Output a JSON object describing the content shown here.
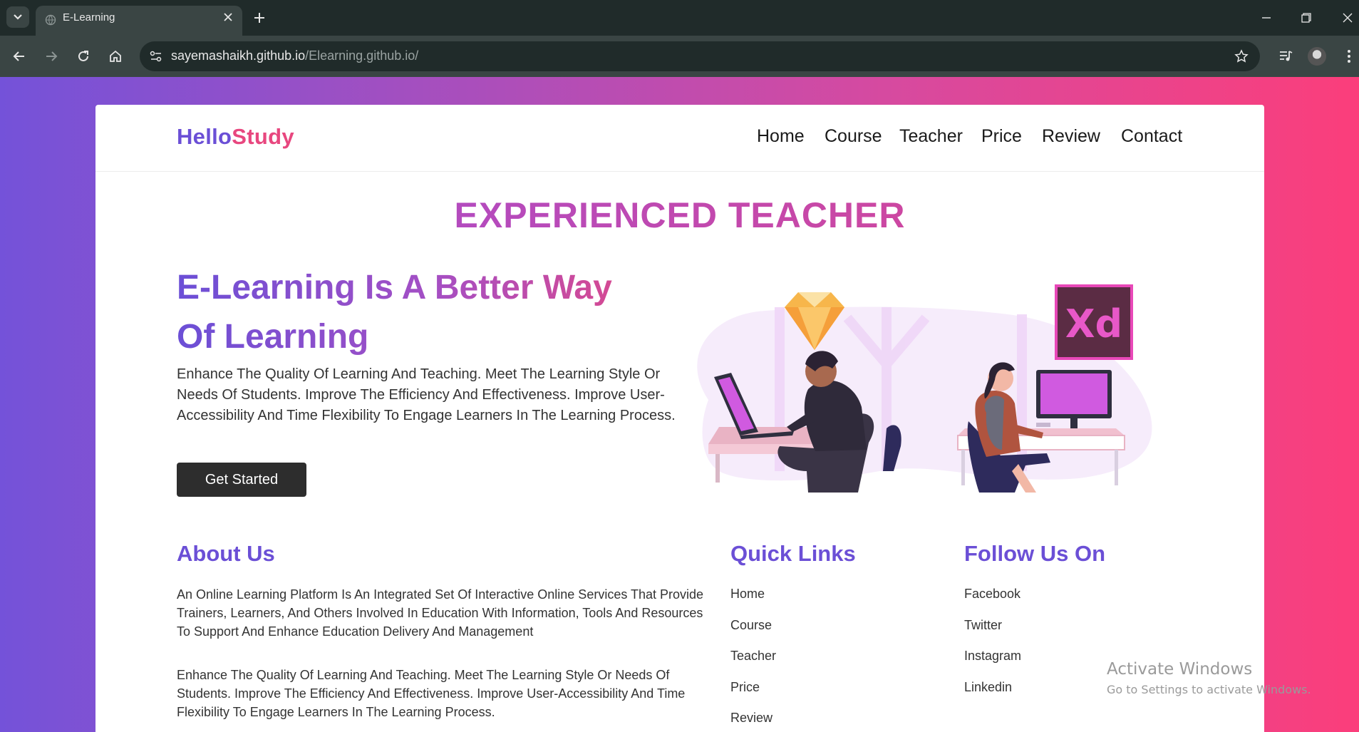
{
  "browser": {
    "tab_title": "E-Learning",
    "url_host": "sayemashaikh.github.io",
    "url_path": "/Elearning.github.io/"
  },
  "site": {
    "logo_part1": "Hello",
    "logo_part2": "Study",
    "nav": [
      "Home",
      "Course",
      "Teacher",
      "Price",
      "Review",
      "Contact"
    ]
  },
  "hero": {
    "section_title": "EXPERIENCED TEACHER",
    "heading_line1": "E-Learning Is A Better Way",
    "heading_line2": "Of Learning",
    "text": "Enhance The Quality Of Learning And Teaching. Meet The Learning Style Or Needs Of Students. Improve The Efficiency And Effectiveness. Improve User-Accessibility And Time Flexibility To Engage Learners In The Learning Process.",
    "cta": "Get Started",
    "badge_label": "Xd"
  },
  "footer": {
    "about_title": "About Us",
    "about_p1": "An Online Learning Platform Is An Integrated Set Of Interactive Online Services That Provide Trainers, Learners, And Others Involved In Education With Information, Tools And Resources To Support And Enhance Education Delivery And Management",
    "about_p2": "Enhance The Quality Of Learning And Teaching. Meet The Learning Style Or Needs Of Students. Improve The Efficiency And Effectiveness. Improve User-Accessibility And Time Flexibility To Engage Learners In The Learning Process.",
    "quick_title": "Quick Links",
    "quick_links": [
      "Home",
      "Course",
      "Teacher",
      "Price",
      "Review"
    ],
    "follow_title": "Follow Us On",
    "follow_links": [
      "Facebook",
      "Twitter",
      "Instagram",
      "Linkedin"
    ]
  },
  "os": {
    "watermark_line1": "Activate Windows",
    "watermark_line2": "Go to Settings to activate Windows."
  },
  "colors": {
    "brand_purple": "#6b4fd6",
    "brand_pink": "#e8477f",
    "button_dark": "#2d2d2d"
  }
}
